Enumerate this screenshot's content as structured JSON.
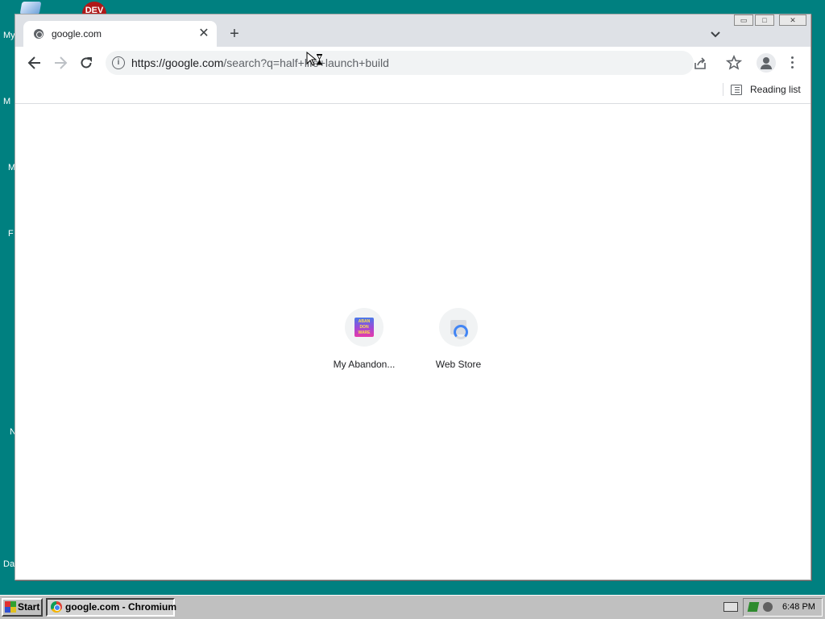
{
  "desktop": {
    "icons": [
      {
        "label": "My",
        "icon": "my-computer-icon"
      },
      {
        "label": "M",
        "icon": "desktop-shortcut-icon"
      },
      {
        "label": "M",
        "icon": "desktop-shortcut-icon"
      },
      {
        "label": "F",
        "icon": "desktop-shortcut-icon"
      },
      {
        "label": "N",
        "icon": "desktop-shortcut-icon"
      },
      {
        "label": "Da",
        "icon": "desktop-shortcut-icon"
      }
    ],
    "dev_badge": "DEV",
    "background_color": "#008080"
  },
  "browser": {
    "tab": {
      "title": "google.com",
      "favicon": "globe-icon",
      "close_glyph": "✕"
    },
    "new_tab_glyph": "+",
    "tab_search_glyph": "⌄",
    "window_buttons": {
      "minimize": "▭",
      "maximize": "□",
      "close": "✕"
    },
    "toolbar": {
      "back_glyph": "←",
      "forward_glyph": "→",
      "reload_glyph": "↻",
      "info_glyph": "i",
      "url_host": "https://google.com",
      "url_path": "/search?q=half+life+launch+build",
      "share_icon": "share-icon",
      "bookmark_icon": "star-icon",
      "profile_icon": "profile-icon",
      "menu_icon": "more-vert-icon"
    },
    "bookmarks_bar": {
      "reading_list": "Reading list"
    },
    "new_tab_page": {
      "shortcuts": [
        {
          "label": "My Abandon...",
          "icon": "abandonware-icon",
          "icon_text": "ABAN DON WARE"
        },
        {
          "label": "Web Store",
          "icon": "web-store-icon"
        }
      ]
    },
    "accent_color": "#1a73e8"
  },
  "taskbar": {
    "start_label": "Start",
    "tasks": [
      {
        "label": "google.com - Chromium",
        "icon": "chromium-icon"
      }
    ],
    "clock": "6:48 PM",
    "background_color": "#c0c0c0"
  }
}
